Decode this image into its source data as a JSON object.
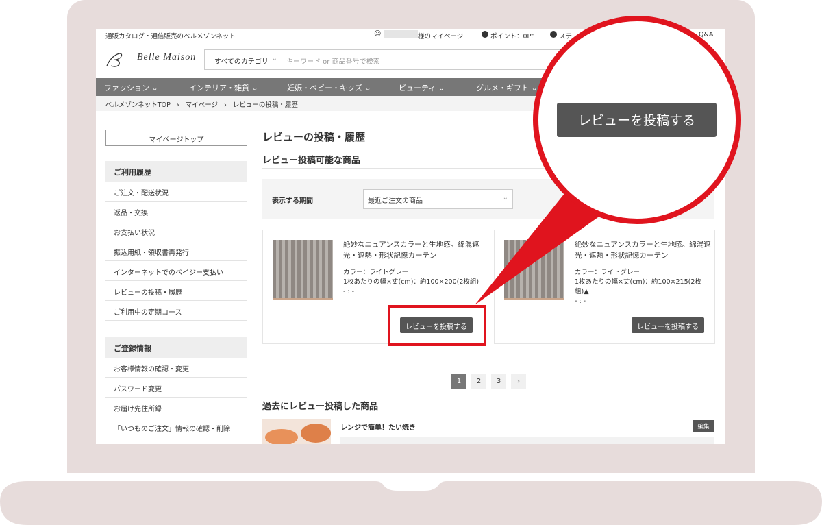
{
  "header": {
    "site_tagline": "通販カタログ・通信販売のベルメゾンネット",
    "mypage": "様のマイページ",
    "points": "ポイント：0Pt",
    "stage": "ステ",
    "qa": "Q&A",
    "logo": "Belle Maison",
    "category_select": "すべてのカテゴリ",
    "search_placeholder": "キーワード or 商品番号で検索"
  },
  "nav": [
    "ファッション",
    "インテリア・雑貨",
    "妊娠・ベビー・キッズ",
    "ビューティ",
    "グルメ・ギフト"
  ],
  "breadcrumb": [
    "ベルメゾンネットTOP",
    "マイページ",
    "レビューの投稿・履歴"
  ],
  "sidebar": {
    "top_button": "マイページトップ",
    "sections": [
      {
        "title": "ご利用履歴",
        "items": [
          "ご注文・配送状況",
          "返品・交換",
          "お支払い状況",
          "振込用紙・領収書再発行",
          "インターネットでのペイジー支払い",
          "レビューの投稿・履歴",
          "ご利用中の定期コース"
        ]
      },
      {
        "title": "ご登録情報",
        "items": [
          "お客様情報の確認・変更",
          "パスワード変更",
          "お届け先住所録",
          "「いつものご注文」情報の確認・削除"
        ]
      }
    ]
  },
  "main": {
    "title": "レビューの投稿・履歴",
    "reviewable_heading": "レビュー投稿可能な商品",
    "filter_label": "表示する期間",
    "filter_value": "最近ご注文の商品",
    "products": [
      {
        "title": "絶妙なニュアンスカラーと生地感。綿混遮光・遮熱・形状記憶カーテン",
        "color": "カラー：ライトグレー",
        "size": "1枚あたりの幅×丈(cm)：約100×200(2枚組)",
        "time": "- : -",
        "button": "レビューを投稿する"
      },
      {
        "title": "絶妙なニュアンスカラーと生地感。綿混遮光・遮熱・形状記憶カーテン",
        "color": "カラー：ライトグレー",
        "size": "1枚あたりの幅×丈(cm)：約100×215(2枚組)▲",
        "time": "- : -",
        "button": "レビューを投稿する"
      }
    ],
    "pagination": [
      "1",
      "2",
      "3",
      "›"
    ],
    "past_heading": "過去にレビュー投稿した商品",
    "past_item": {
      "title": "レンジで簡単！たい焼き",
      "edit": "編集"
    }
  },
  "callout": {
    "button": "レビューを投稿する"
  },
  "colors": {
    "accent_red": "#e0141e",
    "button_gray": "#555555",
    "nav_gray": "#777777"
  }
}
